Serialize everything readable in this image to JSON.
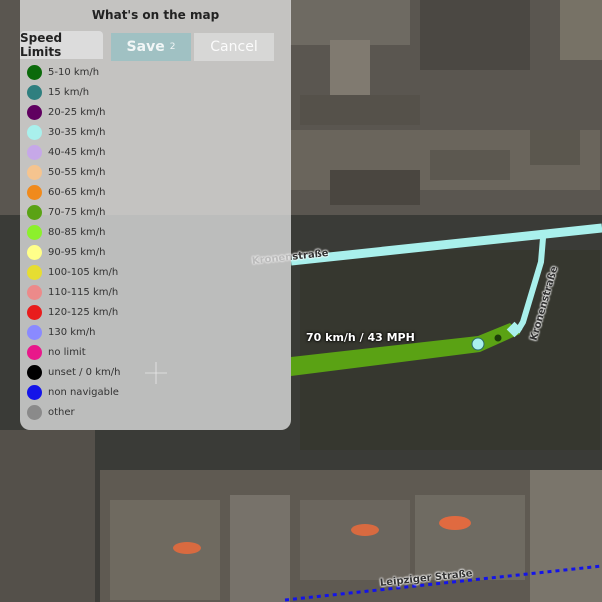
{
  "panel": {
    "title": "What's on the map",
    "tab_label": "Speed Limits"
  },
  "toolbar": {
    "save_label": "Save",
    "save_badge": "2",
    "cancel_label": "Cancel"
  },
  "legend": [
    {
      "label": "5-10 km/h",
      "color": "#0b6a0b"
    },
    {
      "label": "15 km/h",
      "color": "#2f7f7f"
    },
    {
      "label": "20-25 km/h",
      "color": "#600060"
    },
    {
      "label": "30-35 km/h",
      "color": "#a9f0ec"
    },
    {
      "label": "40-45 km/h",
      "color": "#c6a8e8"
    },
    {
      "label": "50-55 km/h",
      "color": "#f5c48f"
    },
    {
      "label": "60-65 km/h",
      "color": "#f08a1c"
    },
    {
      "label": "70-75 km/h",
      "color": "#5aa214"
    },
    {
      "label": "80-85 km/h",
      "color": "#8cf02c"
    },
    {
      "label": "90-95 km/h",
      "color": "#ffff8a"
    },
    {
      "label": "100-105 km/h",
      "color": "#e6dd32"
    },
    {
      "label": "110-115 km/h",
      "color": "#ec8a8a"
    },
    {
      "label": "120-125 km/h",
      "color": "#e81c1c"
    },
    {
      "label": "130 km/h",
      "color": "#8a8aff"
    },
    {
      "label": "no limit",
      "color": "#e8188a"
    },
    {
      "label": "unset / 0 km/h",
      "color": "#000000"
    },
    {
      "label": "non navigable",
      "color": "#1414e8"
    },
    {
      "label": "other",
      "color": "#8a8a8a"
    }
  ],
  "map": {
    "streets": {
      "kronen_main": "Kronenstraße",
      "kronen_side": "Kronenstraße",
      "leipziger": "Leipziger Straße"
    },
    "selected_segment_label": "70 km/h / 43 MPH"
  }
}
